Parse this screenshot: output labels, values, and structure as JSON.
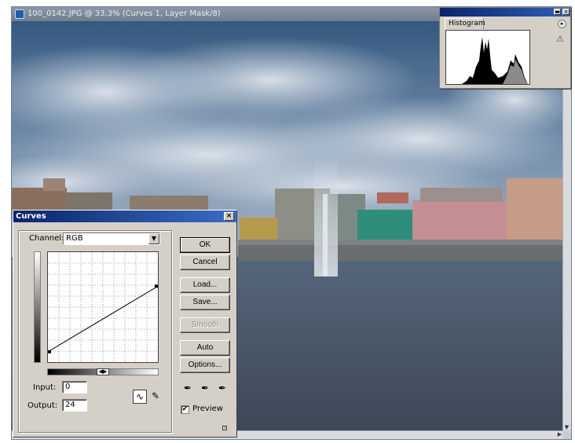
{
  "document": {
    "title": "100_0142.JPG @ 33,3% (Curves 1, Layer Mask/8)"
  },
  "histogram_panel": {
    "tab_label": "Histogram",
    "warning_icon": "warning-triangle-icon",
    "menu_icon": "palette-menu-icon"
  },
  "curves_dialog": {
    "title": "Curves",
    "channel_label": "Channel:",
    "channel_value": "RGB",
    "input_label": "Input:",
    "input_value": "0",
    "output_label": "Output:",
    "output_value": "24",
    "buttons": {
      "ok": "OK",
      "cancel": "Cancel",
      "load": "Load...",
      "save": "Save...",
      "smooth": "Smooth",
      "auto": "Auto",
      "options": "Options..."
    },
    "preview_label": "Preview",
    "preview_checked": true,
    "curve_points": [
      {
        "input": 0,
        "output": 24
      },
      {
        "input": 255,
        "output": 176
      }
    ]
  },
  "colors": {
    "titlebar_active": "#0a246a",
    "dialog_face": "#d4d0c8"
  }
}
